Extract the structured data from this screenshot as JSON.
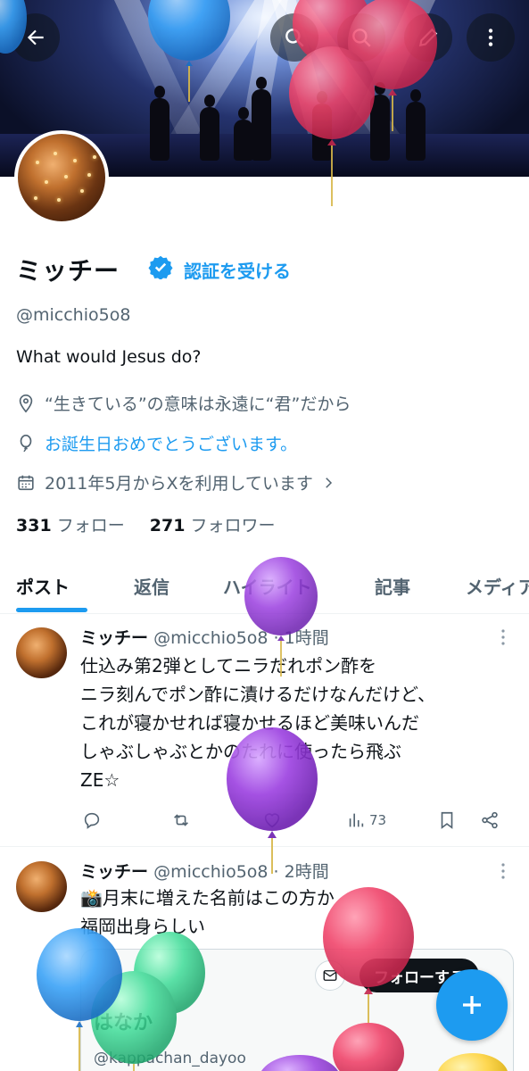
{
  "profile": {
    "name": "ミッチー",
    "verify_link": "認証を受ける",
    "handle": "@micchio5o8",
    "bio": "What would Jesus do?",
    "location": "“生きている”の意味は永遠に“君”だから",
    "birthday": "お誕生日おめでとうございます。",
    "joined": "2011年5月からXを利用しています",
    "following_count": "331",
    "following_label": "フォロー",
    "followers_count": "271",
    "followers_label": "フォロワー"
  },
  "tabs": [
    "ポスト",
    "返信",
    "ハイライト",
    "記事",
    "メディア"
  ],
  "posts": [
    {
      "name": "ミッチー",
      "meta": "@micchio5o8 · 1時間",
      "lines": [
        "仕込み第2弾としてニラだれポン酢を",
        "ニラ刻んでポン酢に漬けるだけなんだけど、",
        "これが寝かせれば寝かせるほど美味いんだ",
        "しゃぶしゃぶとかのたれに使ったら飛ぶ",
        "ZE☆"
      ],
      "views": "73"
    },
    {
      "name": "ミッチー",
      "meta": "@micchio5o8 · 2時間",
      "lines": [
        "📸月末に増えた名前はこの方か",
        "福岡出身らしい"
      ]
    }
  ],
  "card": {
    "follow_label": "フォローする",
    "name": "はなか",
    "handle": "@kappachan_dayoo"
  },
  "colors": {
    "accent": "#1d9bf0",
    "text": "#0f1419",
    "muted": "#536471",
    "balloon_red": "#f0456b",
    "balloon_purple": "#9b3fe0",
    "balloon_blue": "#3ba3f7",
    "balloon_green": "#3fdc98"
  },
  "icons": {
    "back": "arrow-left-icon",
    "search": "search-icon",
    "edit": "pencil-icon",
    "more": "more-vertical-icon",
    "verified": "verified-badge-icon",
    "location": "location-pin-icon",
    "birthday": "balloon-icon",
    "calendar": "calendar-icon",
    "compose": "plus-icon"
  }
}
